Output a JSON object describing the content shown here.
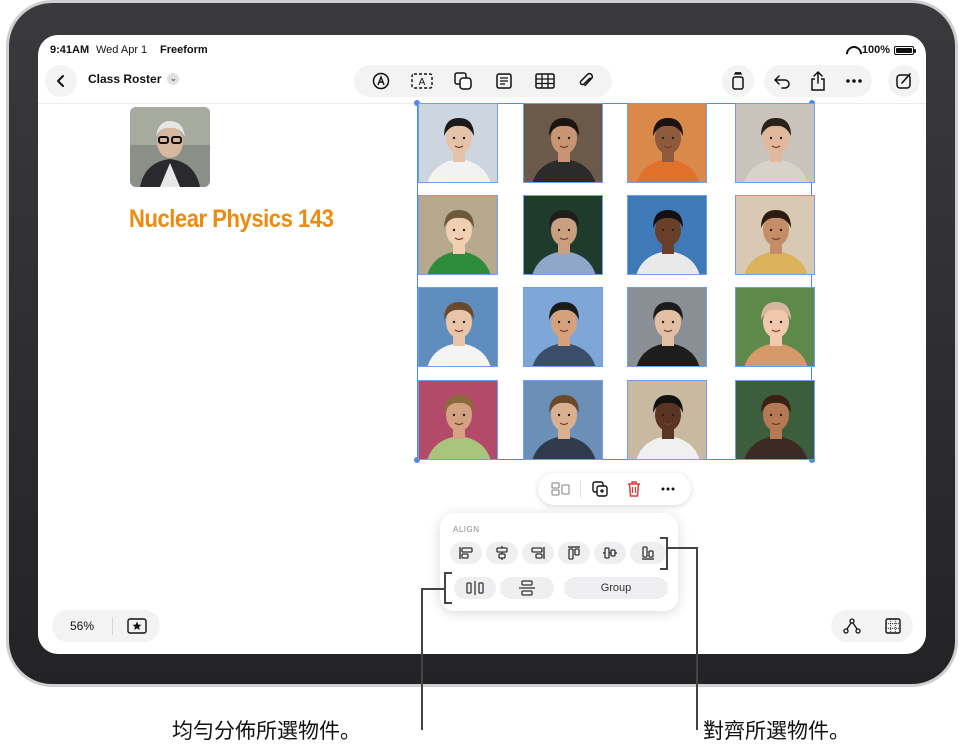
{
  "status_bar": {
    "time": "9:41AM",
    "date": "Wed Apr 1",
    "app": "Freeform",
    "battery": "100%"
  },
  "toolbar": {
    "back_icon": "chevron-left-icon",
    "title": "Class Roster",
    "title_menu_icon": "chevron-down-icon",
    "tools": [
      "pen-icon",
      "text-box-icon",
      "shapes-icon",
      "sticky-note-icon",
      "table-icon",
      "attachment-icon"
    ],
    "right_actions": [
      "copy-icon",
      "undo-icon",
      "share-icon",
      "more-icon",
      "compose-icon"
    ]
  },
  "board": {
    "heading": "Nuclear Physics 143",
    "heading_color": "#ee8a0e",
    "teacher_photo": "teacher-portrait",
    "student_photos": 16
  },
  "context_menu": {
    "items": [
      "align-icon",
      "duplicate-icon",
      "delete-icon",
      "more-icon"
    ]
  },
  "align_panel": {
    "title": "ALIGN",
    "align_buttons": [
      "align-left-icon",
      "align-center-horizontal-icon",
      "align-right-icon",
      "align-top-icon",
      "align-middle-icon",
      "align-bottom-icon"
    ],
    "distribute_buttons": [
      "distribute-horizontal-icon",
      "distribute-vertical-icon"
    ],
    "group_label": "Group"
  },
  "zoom": {
    "level": "56%"
  },
  "callouts": {
    "distribute": "均勻分佈所選物件。",
    "align": "對齊所選物件。"
  }
}
